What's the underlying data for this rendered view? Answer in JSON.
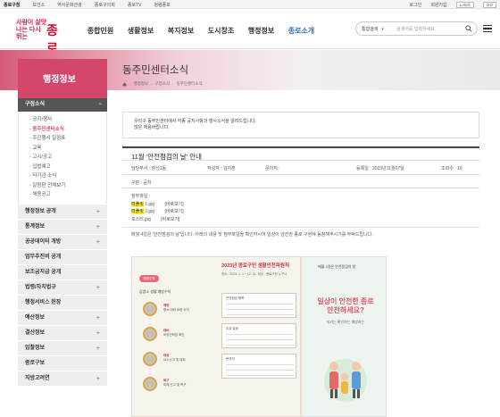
{
  "topbar": {
    "left": [
      "종로구청",
      "보건소",
      "역사문화관광",
      "종로구의회",
      "종로TV",
      "청렴종로"
    ],
    "right": [
      "로그인",
      "회원가입",
      "LANG",
      "GO"
    ]
  },
  "logo": {
    "slogan": "사람이 살맛나는 다시 뛰는",
    "name": "종로"
  },
  "nav": [
    "종합민원",
    "생활정보",
    "복지정보",
    "도시창조",
    "행정정보",
    "종로소개"
  ],
  "nav_active_index": 5,
  "search": {
    "select": "통합검색",
    "placeholder": "검색어를 입력하세요"
  },
  "banner": {
    "title": "동주민센터소식"
  },
  "breadcrumb": [
    "행정정보",
    "구정소식",
    "동주민센터소식"
  ],
  "sidebar": {
    "heading": "행정정보",
    "section": "구정소식",
    "section_toggle": "−",
    "subitems": [
      "공지/행사",
      "동주민센터소식",
      "주간행사 일정표",
      "교육",
      "고시/공고",
      "입법예고",
      "타기관 소식",
      "알림판 전체보기",
      "채용공고"
    ],
    "active_subitem_index": 1,
    "items": [
      "행정정보 공개",
      "통계정보",
      "공공데이터 개방",
      "업무추진비 공개",
      "보조금지급 공개",
      "법령/자치법규",
      "행정서비스 헌장",
      "예산정보",
      "결산정보",
      "입찰정보",
      "종로구보",
      "지방고려연"
    ],
    "expand_symbol": "+"
  },
  "intro": {
    "line1": "우리구 동주민센터에서 각종 공지사항과 행사소식을 알려드립니다.",
    "line2": "많은 애용바랍니다."
  },
  "post": {
    "title": "11월 '안전점검의 날' 안내",
    "department": "담당부서 : 창신1동",
    "author": "작성자 : 김지훈",
    "contact": "문의처 :",
    "date": "등록일 : 2023년11월07일",
    "views": "조회수 : 10",
    "category": "구분 : 공지",
    "attach_label": "첨부파일 :",
    "attachments": [
      {
        "hl": "리플릿",
        "rest": " 1.jpg",
        "view": "[바로보기]"
      },
      {
        "hl": "리플릿",
        "rest": " 2.jpg",
        "view": "[바로보기]"
      },
      {
        "hl": "",
        "rest": "포스터.jpg",
        "view": "[바로보기]"
      }
    ],
    "body": "매월 4일은 '안전점검의 날'입니다. 아래의 내용 및 첨부파일을 확인하시어 일상이 안전한 종로 구현에 동참해주시기를 부탁드립니다."
  },
  "poster1": {
    "header": "2023년 종로구민 생활안전파원칙",
    "subtitle": "장소 : 2023. 1. 1 ~ 12. 31. 대상 : 종로구민 누구나",
    "tag": "예방수칙",
    "section_title": "감염소 생활 예방수칙",
    "captions": [
      {
        "stage": "예방",
        "text": "평소 대비 요령 숙지"
      },
      {
        "stage": "대비",
        "text": "비상연락망 확인"
      },
      {
        "stage": "대응",
        "text": "119 신고 및 대피"
      },
      {
        "stage": "복구",
        "text": "피해 신고 및 복구"
      }
    ],
    "box_titles": [
      "안전점검 항목",
      "주요 일정",
      "문의처"
    ]
  },
  "poster2": {
    "top": "매월 4일은 안전점검의 날",
    "headline": "일상이 안전한 종로 안전하세요?",
    "sub": "지키는 확인하는 예방하는"
  }
}
